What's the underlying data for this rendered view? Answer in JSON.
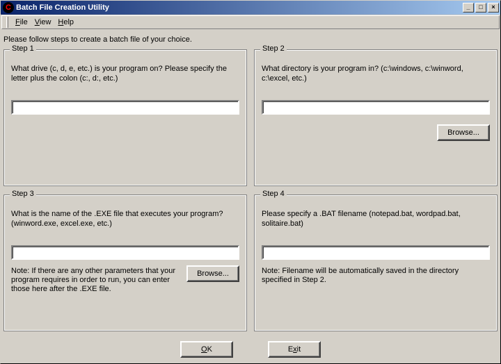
{
  "title": "Batch File Creation Utility",
  "menu": {
    "file": "File",
    "view": "View",
    "help": "Help"
  },
  "intro": "Please follow steps to create a batch file of your choice.",
  "step1": {
    "legend": "Step 1",
    "prompt": "What drive (c, d, e, etc.) is your program on? Please specify the letter plus the colon (c:, d:, etc.)",
    "value": ""
  },
  "step2": {
    "legend": "Step 2",
    "prompt": "What directory is your program in? (c:\\windows, c:\\winword, c:\\excel, etc.)",
    "value": "",
    "browse": "Browse..."
  },
  "step3": {
    "legend": "Step 3",
    "prompt": "What is the name of the .EXE file that executes your program? (winword.exe, excel.exe, etc.)",
    "value": "",
    "browse": "Browse...",
    "note": "Note:  If there are any other parameters that your program requires in order to run, you can enter those here after the .EXE file."
  },
  "step4": {
    "legend": "Step 4",
    "prompt": "Please specify a .BAT filename (notepad.bat, wordpad.bat, solitaire.bat)",
    "value": "",
    "note": "Note:  Filename will be automatically saved in the directory specified in Step 2."
  },
  "buttons": {
    "ok": "OK",
    "ok_u": "O",
    "exit_pre": "E",
    "exit_u": "x",
    "exit_post": "it"
  }
}
